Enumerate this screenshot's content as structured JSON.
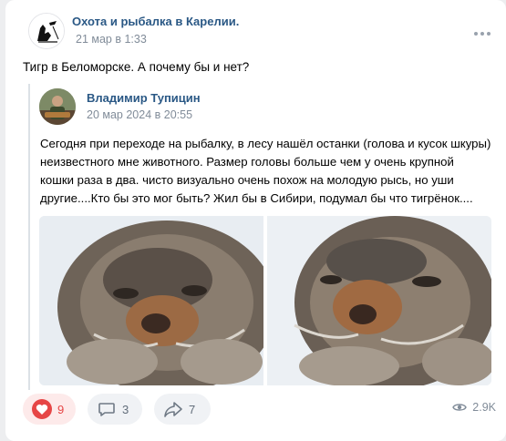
{
  "post": {
    "group_name": "Охота и рыбалка в Карелии.",
    "date": "21 мар в 1:33",
    "text": "Тигр в Беломорске. А почему бы и нет?"
  },
  "repost": {
    "author": "Владимир Тупицин",
    "date": "20 мар 2024 в 20:55",
    "text_lines": [
      "Сегодня при переходе на рыбалку, в лесу нашёл останки (голова и кусок шкуры)",
      "неизвестного мне животного. Размер головы больше чем у очень крупной",
      "кошки раза в два. чисто визуально очень похож на молодую рысь, но уши",
      "другие....Кто бы это мог быть? Жил бы в Сибири, подумал бы что тигрёнок...."
    ]
  },
  "actions": {
    "likes": "9",
    "comments": "3",
    "shares": "7",
    "views": "2.9K"
  },
  "icons": {
    "like": "heart-icon",
    "comment": "comment-icon",
    "share": "share-icon",
    "views": "eye-icon",
    "more": "more-dots-icon"
  },
  "colors": {
    "link": "#2a5885",
    "secondary": "#818c99",
    "like": "#e64646",
    "button_bg": "#f0f2f5",
    "page_bg": "#edeef0"
  }
}
